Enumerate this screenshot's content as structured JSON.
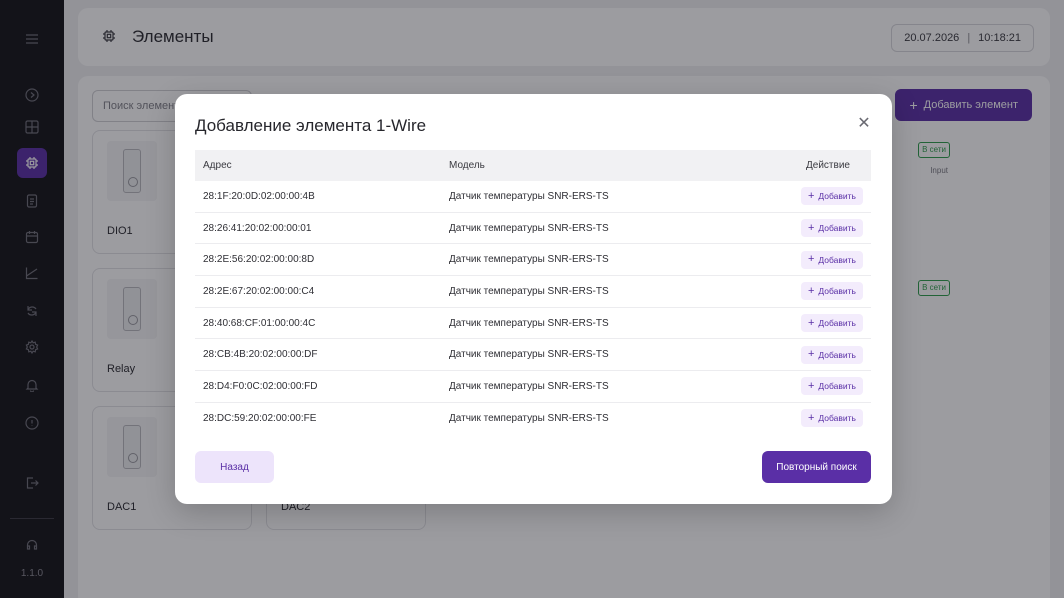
{
  "sidebar": {
    "version": "1.1.0",
    "icons": [
      "menu-icon",
      "dashboard-icon",
      "panels-icon",
      "chip-icon",
      "document-icon",
      "calendar-icon",
      "chart-icon",
      "sync-icon",
      "settings-icon",
      "bell-icon",
      "info-icon",
      "logout-icon",
      "support-icon"
    ]
  },
  "header": {
    "title": "Элементы",
    "date": "20.07.2026",
    "time": "10:18:21",
    "separator": "|"
  },
  "toolbar": {
    "search_placeholder": "Поиск элемент",
    "add_element_label": "Добавить элемент",
    "add_element_plus": "+"
  },
  "cards": [
    {
      "name": "DIO1",
      "badge": "В сети",
      "sub": "Input"
    },
    {
      "name": "Relay",
      "badge": "В сети",
      "sub": ""
    },
    {
      "name": "DAC1",
      "badge": "",
      "sub": ""
    },
    {
      "name": "DAC2",
      "badge": "",
      "sub": ""
    }
  ],
  "modal": {
    "title": "Добавление элемента 1-Wire",
    "close_glyph": "✕",
    "columns": {
      "address": "Адрес",
      "model": "Модель",
      "action": "Действие"
    },
    "rows": [
      {
        "address": "28:1F:20:0D:02:00:00:4B",
        "model": "Датчик температуры SNR-ERS-TS",
        "action": "Добавить"
      },
      {
        "address": "28:26:41:20:02:00:00:01",
        "model": "Датчик температуры SNR-ERS-TS",
        "action": "Добавить"
      },
      {
        "address": "28:2E:56:20:02:00:00:8D",
        "model": "Датчик температуры SNR-ERS-TS",
        "action": "Добавить"
      },
      {
        "address": "28:2E:67:20:02:00:00:C4",
        "model": "Датчик температуры SNR-ERS-TS",
        "action": "Добавить"
      },
      {
        "address": "28:40:68:CF:01:00:00:4C",
        "model": "Датчик температуры SNR-ERS-TS",
        "action": "Добавить"
      },
      {
        "address": "28:CB:4B:20:02:00:00:DF",
        "model": "Датчик температуры SNR-ERS-TS",
        "action": "Добавить"
      },
      {
        "address": "28:D4:F0:0C:02:00:00:FD",
        "model": "Датчик температуры SNR-ERS-TS",
        "action": "Добавить"
      },
      {
        "address": "28:DC:59:20:02:00:00:FE",
        "model": "Датчик температуры SNR-ERS-TS",
        "action": "Добавить"
      }
    ],
    "add_plus": "+",
    "back_label": "Назад",
    "rescan_label": "Повторный поиск"
  },
  "colors": {
    "accent": "#5a2fa6",
    "accent_light": "#ede4fb",
    "sidebar_bg": "#141318",
    "online": "#2e9e4a"
  }
}
